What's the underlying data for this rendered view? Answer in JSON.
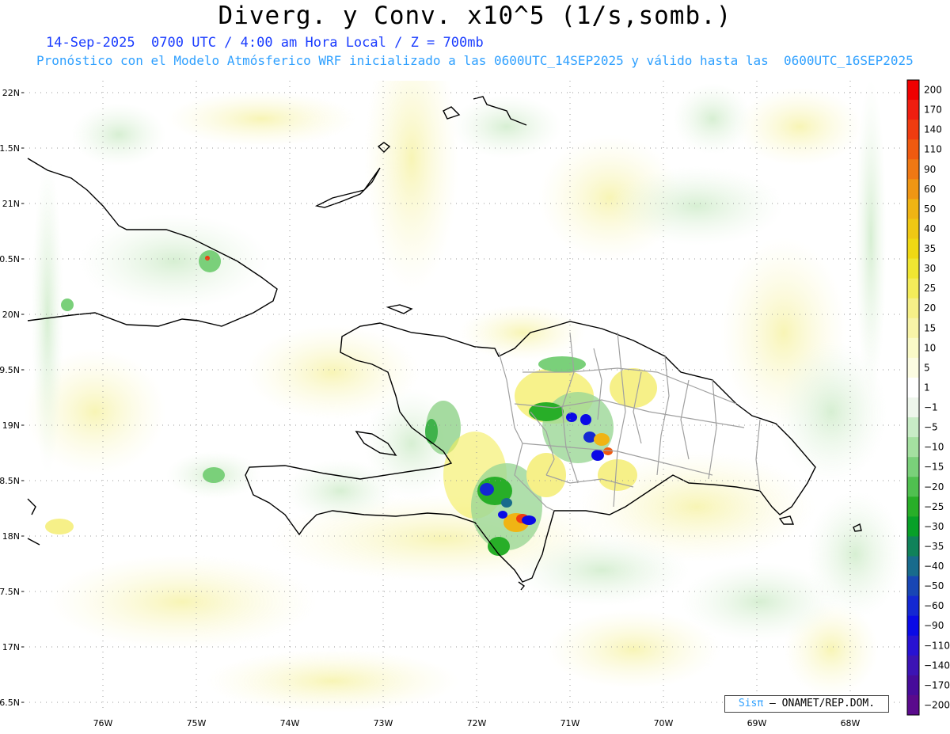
{
  "title": "Diverg. y Conv. x10^5 (1/s,somb.)",
  "subtitle_1": "14-Sep-2025  0700 UTC / 4:00 am Hora Local / Z = 700mb",
  "subtitle_2": "Pronóstico con el Modelo Atmósferico WRF inicializado a las 0600UTC_14SEP2025 y válido hasta las  0600UTC_16SEP2025",
  "credit": {
    "brand": "Sisπ",
    "text": "– ONAMET/REP.DOM."
  },
  "lat_labels": [
    "22N",
    "1.5N",
    "21N",
    "0.5N",
    "20N",
    "9.5N",
    "19N",
    "8.5N",
    "18N",
    "7.5N",
    "17N",
    "6.5N"
  ],
  "lon_labels": [
    "76W",
    "75W",
    "74W",
    "73W",
    "72W",
    "71W",
    "70W",
    "69W",
    "68W"
  ],
  "colorbar": {
    "labels": [
      "200",
      "170",
      "140",
      "110",
      "90",
      "60",
      "50",
      "40",
      "35",
      "30",
      "25",
      "20",
      "15",
      "10",
      "5",
      "1",
      "−1",
      "−5",
      "−10",
      "−15",
      "−20",
      "−25",
      "−30",
      "−35",
      "−40",
      "−50",
      "−60",
      "−90",
      "−110",
      "−140",
      "−170",
      "−200"
    ],
    "colors": [
      "#f00000",
      "#f01e10",
      "#f03c10",
      "#f05a10",
      "#f07814",
      "#f09614",
      "#f0b414",
      "#f0c814",
      "#f0d814",
      "#f0e632",
      "#f4ec5a",
      "#f6f088",
      "#f8f4a8",
      "#fafac8",
      "#fcfce2",
      "#ffffff",
      "#eef6ec",
      "#c8ecc6",
      "#a4e0a0",
      "#7ad07a",
      "#50c050",
      "#28ae28",
      "#08a028",
      "#10825a",
      "#186b8c",
      "#1846b4",
      "#1428d2",
      "#0a0ae6",
      "#2812d2",
      "#3c14b4",
      "#460c9a",
      "#5a0a8c"
    ]
  }
}
